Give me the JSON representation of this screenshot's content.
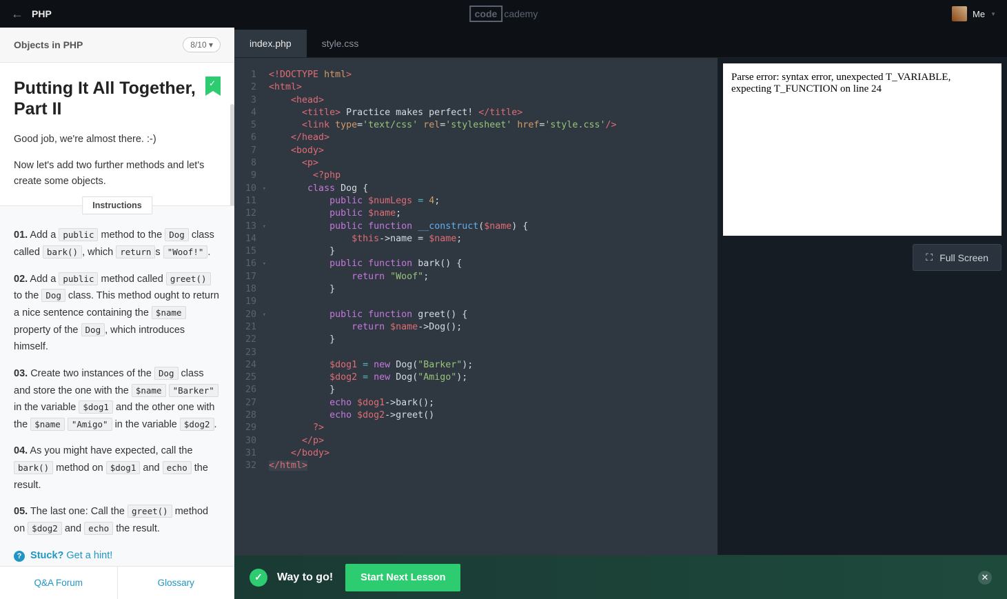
{
  "header": {
    "course": "PHP",
    "logo_boxed": "code",
    "logo_rest": "cademy",
    "user_label": "Me"
  },
  "sidebar": {
    "section": "Objects in PHP",
    "progress": "8/10",
    "title": "Putting It All Together, Part II",
    "intro_1": "Good job, we're almost there. :-)",
    "intro_2": "Now let's add two further methods and let's create some objects.",
    "instructions_label": "Instructions",
    "steps": {
      "s1_num": "01.",
      "s1_a": " Add a ",
      "s1_code1": "public",
      "s1_b": " method to the ",
      "s1_code2": "Dog",
      "s1_c": " class called ",
      "s1_code3": "bark()",
      "s1_d": ", which ",
      "s1_code4": "return",
      "s1_e": "s ",
      "s1_code5": "\"Woof!\"",
      "s1_f": ".",
      "s2_num": "02.",
      "s2_a": " Add a ",
      "s2_code1": "public",
      "s2_b": " method called ",
      "s2_code2": "greet()",
      "s2_c": " to the ",
      "s2_code3": "Dog",
      "s2_d": " class. This method ought to return a nice sentence containing the ",
      "s2_code4": "$name",
      "s2_e": " property of the ",
      "s2_code5": "Dog",
      "s2_f": ", which introduces himself.",
      "s3_num": "03.",
      "s3_a": " Create two instances of the ",
      "s3_code1": "Dog",
      "s3_b": " class and store the one with the ",
      "s3_code2": "$name",
      "s3_c": " ",
      "s3_code3": "\"Barker\"",
      "s3_d": " in the variable ",
      "s3_code4": "$dog1",
      "s3_e": " and the other one with the ",
      "s3_code5": "$name",
      "s3_f": " ",
      "s3_code6": "\"Amigo\"",
      "s3_g": " in the variable ",
      "s3_code7": "$dog2",
      "s3_h": ".",
      "s4_num": "04.",
      "s4_a": " As you might have expected, call the ",
      "s4_code1": "bark()",
      "s4_b": " method on ",
      "s4_code2": "$dog1",
      "s4_c": " and ",
      "s4_code3": "echo",
      "s4_d": " the result.",
      "s5_num": "05.",
      "s5_a": " The last one: Call the ",
      "s5_code1": "greet()",
      "s5_b": " method on ",
      "s5_code2": "$dog2",
      "s5_c": " and ",
      "s5_code3": "echo",
      "s5_d": " the result."
    },
    "hint_stuck": "Stuck?",
    "hint_get": " Get a hint!",
    "tab_forum": "Q&A Forum",
    "tab_glossary": "Glossary"
  },
  "editor": {
    "tabs": {
      "active": "index.php",
      "inactive": "style.css"
    },
    "line_count": 32
  },
  "output": {
    "error_text": "Parse error: syntax error, unexpected T_VARIABLE, expecting T_FUNCTION on line 24",
    "fullscreen": "Full Screen"
  },
  "footer": {
    "message": "Way to go!",
    "button": "Start Next Lesson"
  }
}
